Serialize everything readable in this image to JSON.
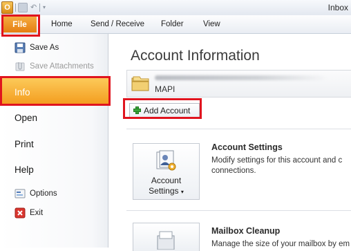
{
  "window": {
    "title": "Inbox"
  },
  "ribbon": {
    "file_tab": "File",
    "tabs": [
      "Home",
      "Send / Receive",
      "Folder",
      "View"
    ]
  },
  "nav": {
    "save_as": "Save As",
    "save_attachments": "Save Attachments",
    "info": "Info",
    "open": "Open",
    "print": "Print",
    "help": "Help",
    "options": "Options",
    "exit": "Exit"
  },
  "main": {
    "title": "Account Information",
    "account_type": "MAPI",
    "add_account": "Add Account",
    "account_settings": {
      "button_line1": "Account",
      "button_line2": "Settings",
      "title": "Account Settings",
      "desc_line1": "Modify settings for this account and c",
      "desc_line2": "connections."
    },
    "mailbox_cleanup": {
      "title": "Mailbox Cleanup",
      "desc_line1": "Manage the size of your mailbox by em"
    }
  },
  "colors": {
    "file_tab": "#e57e12",
    "info_highlight": "#f39a1b",
    "annotation_red": "#e0141e"
  },
  "icons": {
    "save_as": "save-icon",
    "save_attachments": "attachment-icon",
    "options": "options-icon",
    "exit": "exit-icon",
    "account": "folder-account-icon",
    "add": "plus-icon",
    "account_settings": "account-settings-icon",
    "mailbox_cleanup": "mailbox-cleanup-icon"
  }
}
